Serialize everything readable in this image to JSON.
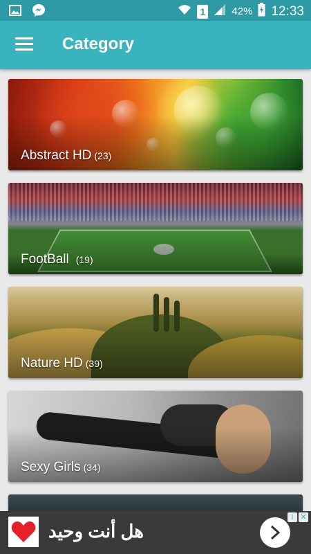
{
  "status_bar": {
    "time": "12:33",
    "battery": "42%",
    "sim_slot": "1",
    "icons": [
      "gallery-icon",
      "messenger-icon",
      "wifi-icon",
      "sim-icon",
      "signal-icon",
      "battery-icon"
    ]
  },
  "app_bar": {
    "title": "Category",
    "menu_icon": "hamburger-menu-icon",
    "background": "#39b4bf"
  },
  "categories": [
    {
      "name": "Abstract HD",
      "count": "(23)"
    },
    {
      "name": "FootBall",
      "count": "(19)"
    },
    {
      "name": "Nature HD",
      "count": "(39)"
    },
    {
      "name": "Sexy Girls",
      "count": "(34)"
    }
  ],
  "ad": {
    "text": "هل أنت وحيد",
    "icon": "heart-icon",
    "action_icon": "chevron-right-icon",
    "info_icons": [
      "info-icon",
      "close-icon"
    ]
  }
}
